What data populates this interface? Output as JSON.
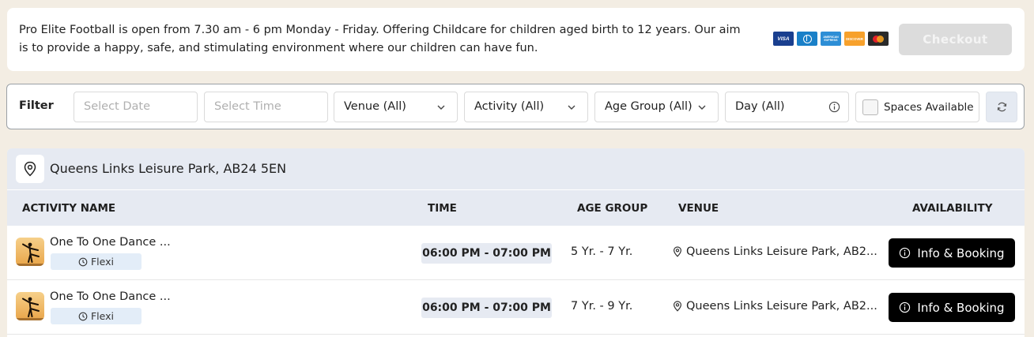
{
  "notice": {
    "text": "Pro Elite Football is open from 7.30 am - 6 pm Monday - Friday. Offering Childcare for children aged birth to 12 years. Our aim is to provide a happy, safe, and stimulating environment where our children can have fun.",
    "payment_icons": [
      "visa-card-icon",
      "diners-club-card-icon",
      "american-express-card-icon",
      "discover-card-icon",
      "mastercard-card-icon"
    ],
    "visa_label": "VISA",
    "amex_label": "AMERICAN EXPRESS",
    "discover_label": "DISCOVER",
    "checkout_label": "Checkout"
  },
  "filter": {
    "label": "Filter",
    "date_placeholder": "Select Date",
    "time_placeholder": "Select Time",
    "venue": "Venue (All)",
    "activity": "Activity (All)",
    "age_group": "Age Group (All)",
    "day": "Day (All)",
    "spaces_available": "Spaces Available",
    "spaces_checked": false
  },
  "venue": {
    "title": "Queens Links Leisure Park, AB24 5EN"
  },
  "table": {
    "headers": {
      "activity_name": "ACTIVITY NAME",
      "time": "TIME",
      "age_group": "AGE GROUP",
      "venue": "VENUE",
      "availability": "AVAILABILITY"
    },
    "rows": [
      {
        "name": "One To One Dance ...",
        "tag": "Flexi",
        "time": "06:00 PM - 07:00 PM",
        "age": "5 Yr. - 7 Yr.",
        "venue": "Queens Links Leisure Park, AB2...",
        "button": "Info & Booking"
      },
      {
        "name": "One To One Dance ...",
        "tag": "Flexi",
        "time": "06:00 PM - 07:00 PM",
        "age": "7 Yr. - 9 Yr.",
        "venue": "Queens Links Leisure Park, AB2...",
        "button": "Info & Booking"
      }
    ]
  },
  "colors": {
    "page_bg": "#f3ede3",
    "header_bg": "#e6eaf2",
    "button_primary": "#000000",
    "checkout_disabled": "#dcdcdc"
  }
}
